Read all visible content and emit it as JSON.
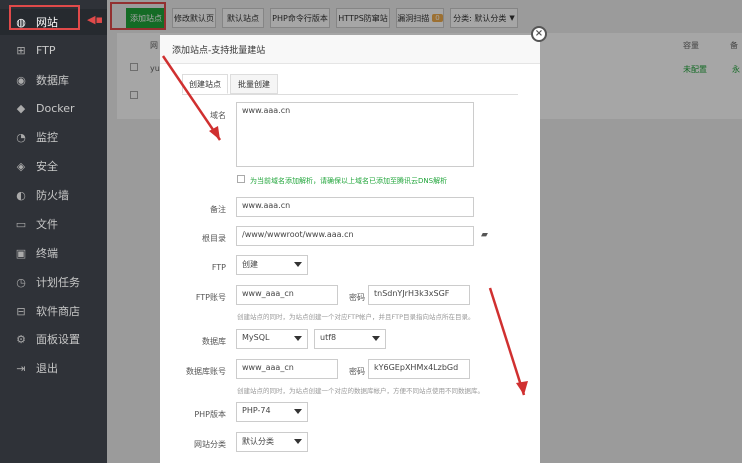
{
  "sidebar": {
    "items": [
      {
        "label": "网站",
        "icon": "globe-icon",
        "glyph": "◍"
      },
      {
        "label": "FTP",
        "icon": "ftp-icon",
        "glyph": "⊞"
      },
      {
        "label": "数据库",
        "icon": "database-icon",
        "glyph": "◉"
      },
      {
        "label": "Docker",
        "icon": "docker-icon",
        "glyph": "◆"
      },
      {
        "label": "监控",
        "icon": "monitor-icon",
        "glyph": "◔"
      },
      {
        "label": "安全",
        "icon": "shield-icon",
        "glyph": "◈"
      },
      {
        "label": "防火墙",
        "icon": "firewall-icon",
        "glyph": "◐"
      },
      {
        "label": "文件",
        "icon": "folder-icon",
        "glyph": "▭"
      },
      {
        "label": "终端",
        "icon": "terminal-icon",
        "glyph": "▣"
      },
      {
        "label": "计划任务",
        "icon": "clock-icon",
        "glyph": "◷"
      },
      {
        "label": "软件商店",
        "icon": "store-icon",
        "glyph": "⊟"
      },
      {
        "label": "面板设置",
        "icon": "gear-icon",
        "glyph": "⚙"
      },
      {
        "label": "退出",
        "icon": "logout-icon",
        "glyph": "⇥"
      }
    ]
  },
  "toolbar": {
    "add_site": "添加站点",
    "modify_default_page": "修改默认页",
    "default_site": "默认站点",
    "php_cli": "PHP命令行版本",
    "https_anti": "HTTPS防窜站",
    "vuln_scan": "漏洞扫描",
    "vuln_count": "0",
    "category": "分类: 默认分类"
  },
  "table": {
    "h_first": "网",
    "h_capacity": "容量",
    "h_last": "备",
    "row1_first": "yu",
    "row1_config": "未配置",
    "row1_last": "永"
  },
  "modal": {
    "title": "添加站点-支持批量建站",
    "close": "×",
    "tabs": [
      "创建站点",
      "批量创建"
    ],
    "domain_label": "域名",
    "domain_value": "www.aaa.cn",
    "dns_hint": "为当前域名添加解析，请确保以上域名已添加至腾讯云DNS解析",
    "remark_label": "备注",
    "remark_value": "www.aaa.cn",
    "root_label": "根目录",
    "root_value": "/www/wwwroot/www.aaa.cn",
    "ftp_label": "FTP",
    "ftp_value": "创建",
    "ftp_account_label": "FTP账号",
    "ftp_account_value": "www_aaa_cn",
    "pwd_label": "密码",
    "ftp_pwd_value": "tnSdnYJrH3k3xSGF",
    "ftp_hint": "创建站点的同时，为站点创建一个对应FTP帐户，并且FTP目录指向站点所在目录。",
    "db_label": "数据库",
    "db_value": "MySQL",
    "charset_value": "utf8",
    "db_account_label": "数据库账号",
    "db_account_value": "www_aaa_cn",
    "db_pwd_value": "kY6GEpXHMx4LzbGd",
    "db_hint": "创建站点的同时，为站点创建一个对应的数据库帐户，方便不同站点使用不同数据库。",
    "php_label": "PHP版本",
    "php_value": "PHP-74",
    "cat_label": "网站分类",
    "cat_value": "默认分类"
  }
}
